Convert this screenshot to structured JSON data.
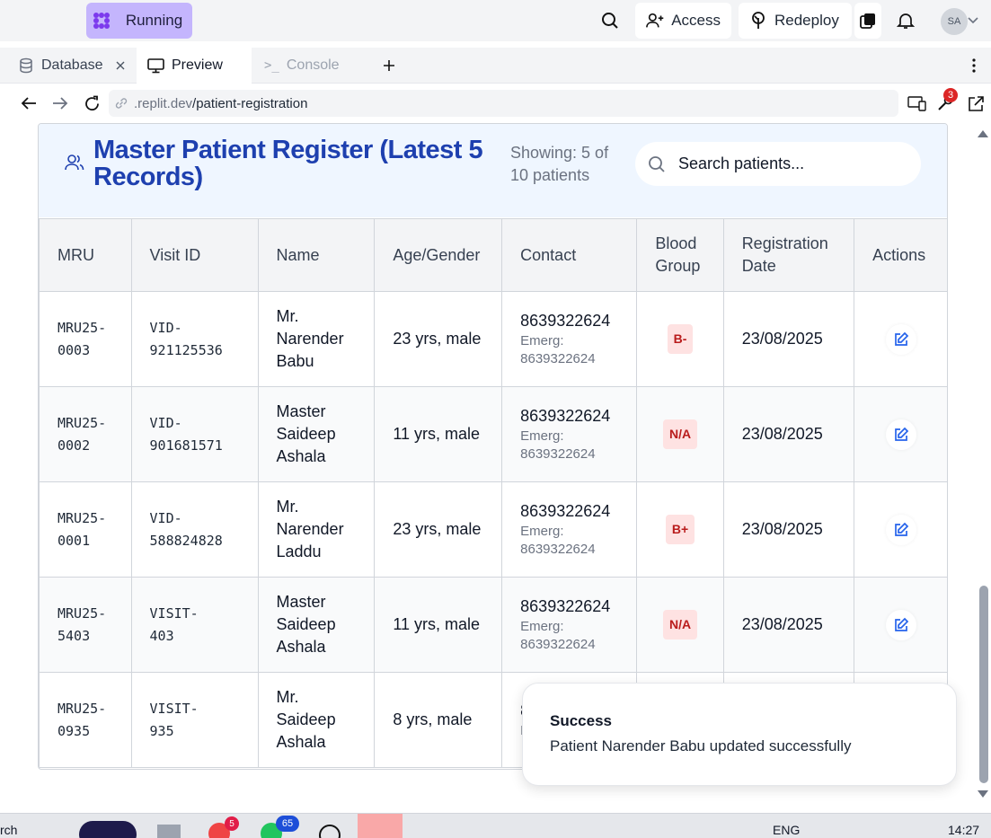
{
  "topbar": {
    "status_label": "Running",
    "access_label": "Access",
    "redeploy_label": "Redeploy",
    "avatar_initials": "SA"
  },
  "tabs": [
    {
      "label": "Database"
    },
    {
      "label": "Preview"
    },
    {
      "label": "Console"
    }
  ],
  "url": {
    "host": ".replit.dev",
    "path": "/patient-registration",
    "notification_count": "3"
  },
  "register": {
    "title": "Master Patient Register (Latest 5 Records)",
    "showing": "Showing: 5 of 10 patients",
    "search_placeholder": "Search patients...",
    "columns": [
      "MRU",
      "Visit ID",
      "Name",
      "Age/Gender",
      "Contact",
      "Blood Group",
      "Registration Date",
      "Actions"
    ],
    "rows": [
      {
        "mru": "MRU25-0003",
        "visit": "VID-921125536",
        "name": "Mr. Narender Babu",
        "age": "23 yrs, male",
        "contact": "8639322624",
        "emerg": "Emerg: 8639322624",
        "blood": "B-",
        "date": "23/08/2025"
      },
      {
        "mru": "MRU25-0002",
        "visit": "VID-901681571",
        "name": "Master Saideep Ashala",
        "age": "11 yrs, male",
        "contact": "8639322624",
        "emerg": "Emerg: 8639322624",
        "blood": "N/A",
        "date": "23/08/2025"
      },
      {
        "mru": "MRU25-0001",
        "visit": "VID-588824828",
        "name": "Mr. Narender Laddu",
        "age": "23 yrs, male",
        "contact": "8639322624",
        "emerg": "Emerg: 8639322624",
        "blood": "B+",
        "date": "23/08/2025"
      },
      {
        "mru": "MRU25-5403",
        "visit": "VISIT-403",
        "name": "Master Saideep Ashala",
        "age": "11 yrs, male",
        "contact": "8639322624",
        "emerg": "Emerg: 8639322624",
        "blood": "N/A",
        "date": "23/08/2025"
      },
      {
        "mru": "MRU25-0935",
        "visit": "VISIT-935",
        "name": "Mr. Saideep Ashala",
        "age": "8 yrs, male",
        "contact": "8",
        "emerg": "E",
        "blood": "",
        "date": ""
      }
    ]
  },
  "toast": {
    "title": "Success",
    "message": "Patient Narender Babu updated successfully"
  },
  "taskbar": {
    "search_fragment": "rch",
    "badge_a": "5",
    "badge_b": "65",
    "lang": "ENG",
    "time": "14:27"
  },
  "colors": {
    "accent": "#1e40af",
    "running_bg": "#c4b5fd",
    "badge_bg": "#fee2e2",
    "badge_fg": "#b91c1c",
    "edit_icon": "#2563eb"
  }
}
